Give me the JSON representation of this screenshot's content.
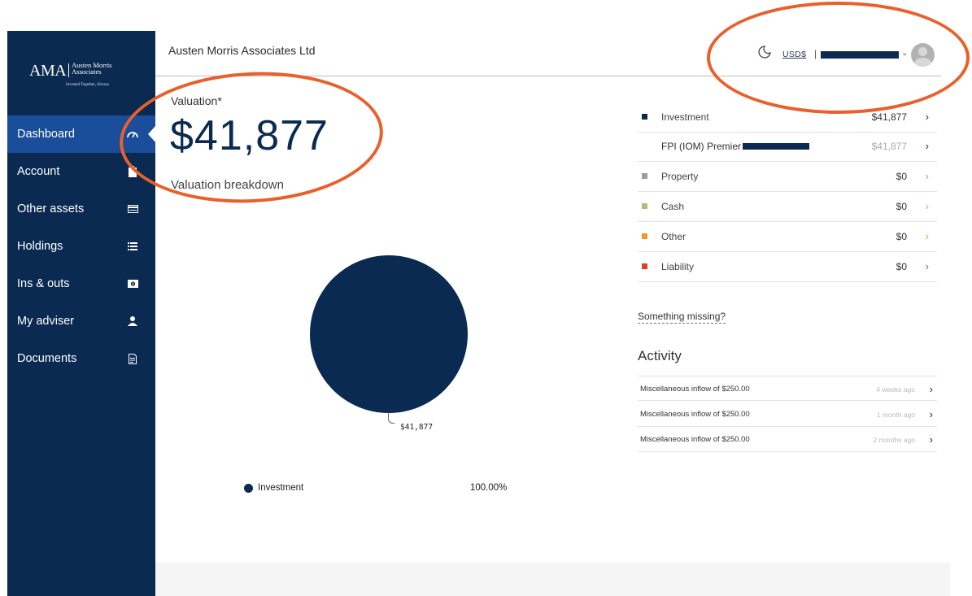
{
  "brand": {
    "logo_main": "AMA",
    "logo_line1": "Austen Morris",
    "logo_line2": "Associates",
    "tagline": "Invested Together, Always"
  },
  "sidebar": {
    "items": [
      {
        "label": "Dashboard",
        "icon": "speedometer-icon",
        "active": true
      },
      {
        "label": "Account",
        "icon": "clipboard-icon",
        "active": false
      },
      {
        "label": "Other assets",
        "icon": "card-icon",
        "active": false
      },
      {
        "label": "Holdings",
        "icon": "list-icon",
        "active": false
      },
      {
        "label": "Ins & outs",
        "icon": "cash-icon",
        "active": false
      },
      {
        "label": "My adviser",
        "icon": "person-icon",
        "active": false
      },
      {
        "label": "Documents",
        "icon": "document-icon",
        "active": false
      }
    ]
  },
  "header": {
    "company": "Austen Morris Associates Ltd",
    "theme_icon": "moon-icon",
    "currency": "USD$",
    "separator": "|"
  },
  "valuation": {
    "label": "Valuation*",
    "value": "$41,877",
    "breakdown_label": "Valuation breakdown"
  },
  "chart": {
    "slice_label": "$41,877",
    "legend_name": "Investment",
    "legend_pct": "100.00%"
  },
  "chart_data": {
    "type": "pie",
    "categories": [
      "Investment"
    ],
    "values": [
      41877
    ],
    "labels": [
      "$41,877"
    ],
    "percentages": [
      "100.00%"
    ],
    "colors": [
      "#0b2a52"
    ]
  },
  "assets": [
    {
      "name": "Investment",
      "value": "$41,877",
      "color": "#0b2a52",
      "arrow": "›",
      "arrow_color": "#0b2a52",
      "sub": false
    },
    {
      "name": "FPI (IOM) Premier",
      "value": "$41,877",
      "color": "",
      "arrow": "›",
      "arrow_color": "#0b2a52",
      "sub": true
    },
    {
      "name": "Property",
      "value": "$0",
      "color": "#9e9e9e",
      "arrow": "›",
      "arrow_color": "#9e9e9e",
      "sub": false
    },
    {
      "name": "Cash",
      "value": "$0",
      "color": "#a8c27a",
      "arrow": "›",
      "arrow_color": "#a8c27a",
      "sub": false
    },
    {
      "name": "Other",
      "value": "$0",
      "color": "#f09a2e",
      "arrow": "›",
      "arrow_color": "#f09a2e",
      "sub": false
    },
    {
      "name": "Liability",
      "value": "$0",
      "color": "#d9412f",
      "arrow": "›",
      "arrow_color": "#d9412f",
      "sub": false
    }
  ],
  "missing_link": "Something missing?",
  "activity": {
    "title": "Activity",
    "items": [
      {
        "text": "Miscellaneous inflow of $250.00",
        "time": "4 weeks ago"
      },
      {
        "text": "Miscellaneous inflow of $250.00",
        "time": "1 month ago"
      },
      {
        "text": "Miscellaneous inflow of $250.00",
        "time": "2 months ago"
      }
    ]
  },
  "colors": {
    "sidebar": "#0b2a52",
    "active": "#1a4d9a",
    "annotation": "#ea5f2a"
  }
}
